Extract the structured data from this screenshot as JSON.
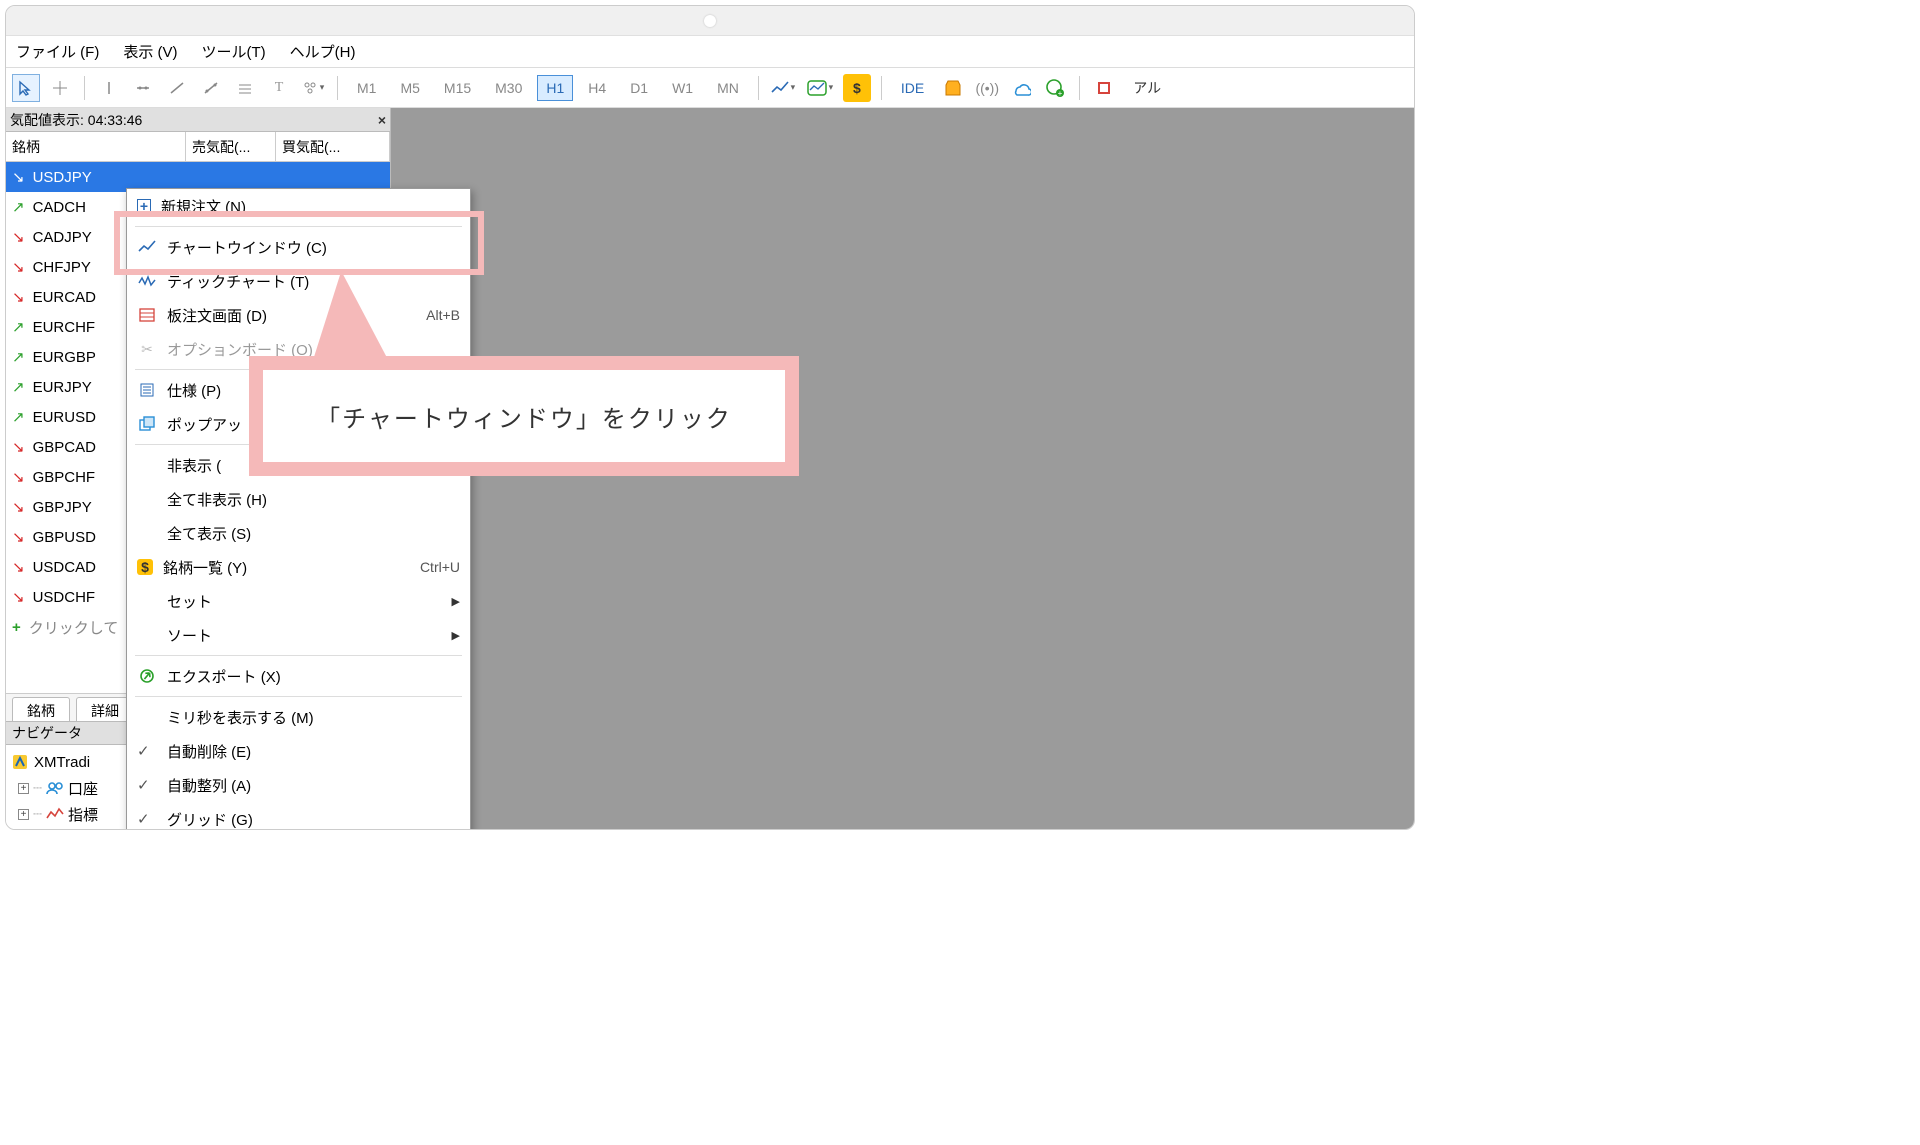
{
  "menu": {
    "file": "ファイル (F)",
    "view": "表示 (V)",
    "tool": "ツール(T)",
    "help": "ヘルプ(H)"
  },
  "timeframes": {
    "m1": "M1",
    "m5": "M5",
    "m15": "M15",
    "m30": "M30",
    "h1": "H1",
    "h4": "H4",
    "d1": "D1",
    "w1": "W1",
    "mn": "MN"
  },
  "toolbar_text": {
    "ide": "IDE",
    "al": "アル"
  },
  "market_watch": {
    "title": "気配値表示: 04:33:46",
    "col1": "銘柄",
    "col2": "売気配(...",
    "col3": "買気配(...",
    "symbols": [
      {
        "dir": "down",
        "sym": "USDJPY",
        "selected": true
      },
      {
        "dir": "up",
        "sym": "CADCH"
      },
      {
        "dir": "down",
        "sym": "CADJPY"
      },
      {
        "dir": "down",
        "sym": "CHFJPY"
      },
      {
        "dir": "down",
        "sym": "EURCAD"
      },
      {
        "dir": "up",
        "sym": "EURCHF"
      },
      {
        "dir": "up",
        "sym": "EURGBP"
      },
      {
        "dir": "up",
        "sym": "EURJPY"
      },
      {
        "dir": "up",
        "sym": "EURUSD"
      },
      {
        "dir": "down",
        "sym": "GBPCAD"
      },
      {
        "dir": "down",
        "sym": "GBPCHF"
      },
      {
        "dir": "down",
        "sym": "GBPJPY"
      },
      {
        "dir": "down",
        "sym": "GBPUSD"
      },
      {
        "dir": "down",
        "sym": "USDCAD"
      },
      {
        "dir": "down",
        "sym": "USDCHF"
      }
    ],
    "click_add": "クリックして",
    "tab1": "銘柄",
    "tab2": "詳細"
  },
  "navigator": {
    "title": "ナビゲータ",
    "root": "XMTradi",
    "accounts": "口座",
    "indicators": "指標"
  },
  "context": {
    "new_order": "新規注文 (N)",
    "chart_window": "チャートウインドウ (C)",
    "tick_chart": "ティックチャート (T)",
    "depth": "板注文画面 (D)",
    "depth_sc": "Alt+B",
    "option_board": "オプションボード (O)",
    "spec": "仕様 (P)",
    "popup": "ポップアッ",
    "hide": "非表示 (",
    "hide_all": "全て非表示 (H)",
    "show_all": "全て表示 (S)",
    "symbol_list": "銘柄一覧 (Y)",
    "symbol_sc": "Ctrl+U",
    "set": "セット",
    "sort": "ソート",
    "export": "エクスポート (X)",
    "millis": "ミリ秒を表示する (M)",
    "auto_delete": "自動削除 (E)",
    "auto_arrange": "自動整列 (A)",
    "grid": "グリッド (G)"
  },
  "callout_text": "「チャートウィンドウ」をクリック"
}
